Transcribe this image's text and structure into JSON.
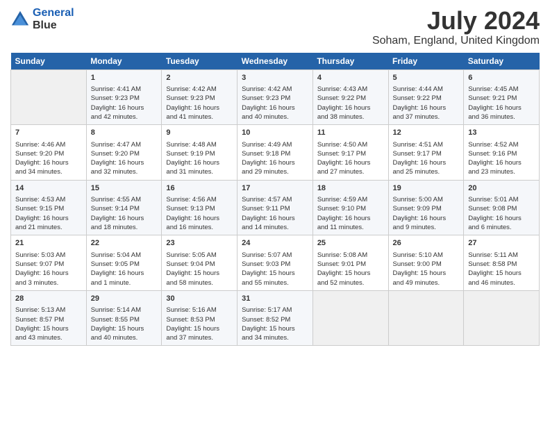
{
  "logo": {
    "line1": "General",
    "line2": "Blue"
  },
  "title": "July 2024",
  "location": "Soham, England, United Kingdom",
  "days_header": [
    "Sunday",
    "Monday",
    "Tuesday",
    "Wednesday",
    "Thursday",
    "Friday",
    "Saturday"
  ],
  "weeks": [
    [
      {
        "day": "",
        "content": ""
      },
      {
        "day": "1",
        "content": "Sunrise: 4:41 AM\nSunset: 9:23 PM\nDaylight: 16 hours\nand 42 minutes."
      },
      {
        "day": "2",
        "content": "Sunrise: 4:42 AM\nSunset: 9:23 PM\nDaylight: 16 hours\nand 41 minutes."
      },
      {
        "day": "3",
        "content": "Sunrise: 4:42 AM\nSunset: 9:23 PM\nDaylight: 16 hours\nand 40 minutes."
      },
      {
        "day": "4",
        "content": "Sunrise: 4:43 AM\nSunset: 9:22 PM\nDaylight: 16 hours\nand 38 minutes."
      },
      {
        "day": "5",
        "content": "Sunrise: 4:44 AM\nSunset: 9:22 PM\nDaylight: 16 hours\nand 37 minutes."
      },
      {
        "day": "6",
        "content": "Sunrise: 4:45 AM\nSunset: 9:21 PM\nDaylight: 16 hours\nand 36 minutes."
      }
    ],
    [
      {
        "day": "7",
        "content": "Sunrise: 4:46 AM\nSunset: 9:20 PM\nDaylight: 16 hours\nand 34 minutes."
      },
      {
        "day": "8",
        "content": "Sunrise: 4:47 AM\nSunset: 9:20 PM\nDaylight: 16 hours\nand 32 minutes."
      },
      {
        "day": "9",
        "content": "Sunrise: 4:48 AM\nSunset: 9:19 PM\nDaylight: 16 hours\nand 31 minutes."
      },
      {
        "day": "10",
        "content": "Sunrise: 4:49 AM\nSunset: 9:18 PM\nDaylight: 16 hours\nand 29 minutes."
      },
      {
        "day": "11",
        "content": "Sunrise: 4:50 AM\nSunset: 9:17 PM\nDaylight: 16 hours\nand 27 minutes."
      },
      {
        "day": "12",
        "content": "Sunrise: 4:51 AM\nSunset: 9:17 PM\nDaylight: 16 hours\nand 25 minutes."
      },
      {
        "day": "13",
        "content": "Sunrise: 4:52 AM\nSunset: 9:16 PM\nDaylight: 16 hours\nand 23 minutes."
      }
    ],
    [
      {
        "day": "14",
        "content": "Sunrise: 4:53 AM\nSunset: 9:15 PM\nDaylight: 16 hours\nand 21 minutes."
      },
      {
        "day": "15",
        "content": "Sunrise: 4:55 AM\nSunset: 9:14 PM\nDaylight: 16 hours\nand 18 minutes."
      },
      {
        "day": "16",
        "content": "Sunrise: 4:56 AM\nSunset: 9:13 PM\nDaylight: 16 hours\nand 16 minutes."
      },
      {
        "day": "17",
        "content": "Sunrise: 4:57 AM\nSunset: 9:11 PM\nDaylight: 16 hours\nand 14 minutes."
      },
      {
        "day": "18",
        "content": "Sunrise: 4:59 AM\nSunset: 9:10 PM\nDaylight: 16 hours\nand 11 minutes."
      },
      {
        "day": "19",
        "content": "Sunrise: 5:00 AM\nSunset: 9:09 PM\nDaylight: 16 hours\nand 9 minutes."
      },
      {
        "day": "20",
        "content": "Sunrise: 5:01 AM\nSunset: 9:08 PM\nDaylight: 16 hours\nand 6 minutes."
      }
    ],
    [
      {
        "day": "21",
        "content": "Sunrise: 5:03 AM\nSunset: 9:07 PM\nDaylight: 16 hours\nand 3 minutes."
      },
      {
        "day": "22",
        "content": "Sunrise: 5:04 AM\nSunset: 9:05 PM\nDaylight: 16 hours\nand 1 minute."
      },
      {
        "day": "23",
        "content": "Sunrise: 5:05 AM\nSunset: 9:04 PM\nDaylight: 15 hours\nand 58 minutes."
      },
      {
        "day": "24",
        "content": "Sunrise: 5:07 AM\nSunset: 9:03 PM\nDaylight: 15 hours\nand 55 minutes."
      },
      {
        "day": "25",
        "content": "Sunrise: 5:08 AM\nSunset: 9:01 PM\nDaylight: 15 hours\nand 52 minutes."
      },
      {
        "day": "26",
        "content": "Sunrise: 5:10 AM\nSunset: 9:00 PM\nDaylight: 15 hours\nand 49 minutes."
      },
      {
        "day": "27",
        "content": "Sunrise: 5:11 AM\nSunset: 8:58 PM\nDaylight: 15 hours\nand 46 minutes."
      }
    ],
    [
      {
        "day": "28",
        "content": "Sunrise: 5:13 AM\nSunset: 8:57 PM\nDaylight: 15 hours\nand 43 minutes."
      },
      {
        "day": "29",
        "content": "Sunrise: 5:14 AM\nSunset: 8:55 PM\nDaylight: 15 hours\nand 40 minutes."
      },
      {
        "day": "30",
        "content": "Sunrise: 5:16 AM\nSunset: 8:53 PM\nDaylight: 15 hours\nand 37 minutes."
      },
      {
        "day": "31",
        "content": "Sunrise: 5:17 AM\nSunset: 8:52 PM\nDaylight: 15 hours\nand 34 minutes."
      },
      {
        "day": "",
        "content": ""
      },
      {
        "day": "",
        "content": ""
      },
      {
        "day": "",
        "content": ""
      }
    ]
  ]
}
